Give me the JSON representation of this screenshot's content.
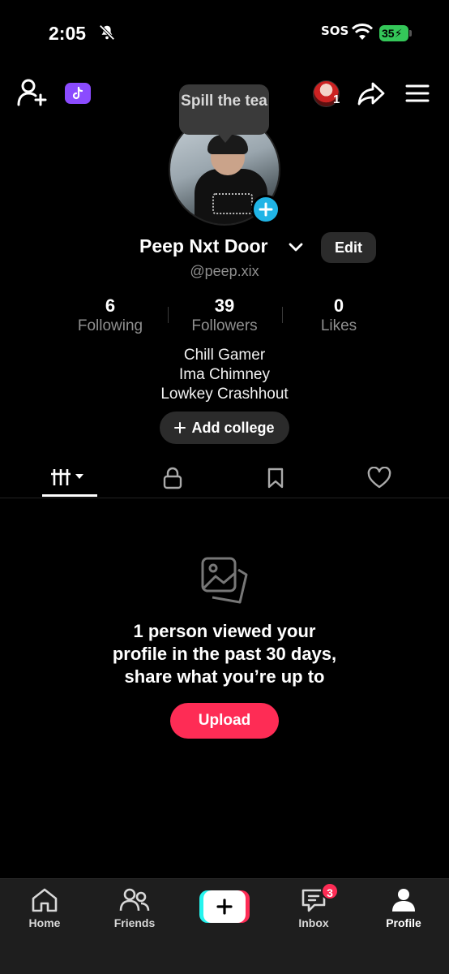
{
  "status_bar": {
    "time": "2:05",
    "carrier": "SOS",
    "battery": "35",
    "icons": [
      "bell-off-icon",
      "wifi-icon",
      "battery-charging-icon"
    ]
  },
  "top_bar": {
    "left_icons": [
      "add-friend-icon",
      "tiktok-icon"
    ],
    "viewer_count": "1",
    "right_icons": [
      "share-icon",
      "menu-icon"
    ]
  },
  "profile": {
    "bubble": "Spill the tea",
    "display_name": "Peep Nxt Door",
    "edit_label": "Edit",
    "username": "@peep.xix",
    "stats": [
      {
        "value": "6",
        "label": "Following"
      },
      {
        "value": "39",
        "label": "Followers"
      },
      {
        "value": "0",
        "label": "Likes"
      }
    ],
    "bio": [
      "Chill Gamer",
      "Ima Chimney",
      "Lowkey Crashhout"
    ],
    "add_college_label": "Add college"
  },
  "tabs": [
    "videos-grid-icon",
    "lock-icon",
    "bookmark-icon",
    "heart-icon"
  ],
  "empty_state": {
    "lines": [
      "1 person viewed your",
      "profile in the past 30 days,",
      "share what you’re up to"
    ],
    "upload_label": "Upload"
  },
  "bottom_nav": {
    "items": [
      {
        "label": "Home"
      },
      {
        "label": "Friends"
      },
      {
        "label": "Inbox",
        "badge": "3"
      },
      {
        "label": "Profile"
      }
    ]
  },
  "colors": {
    "accent": "#fe2c55",
    "cyan": "#25f4ee",
    "add_avatar_blue": "#20b4e6",
    "tiktok_purple": "#8b4bff",
    "battery_green": "#34c759"
  }
}
